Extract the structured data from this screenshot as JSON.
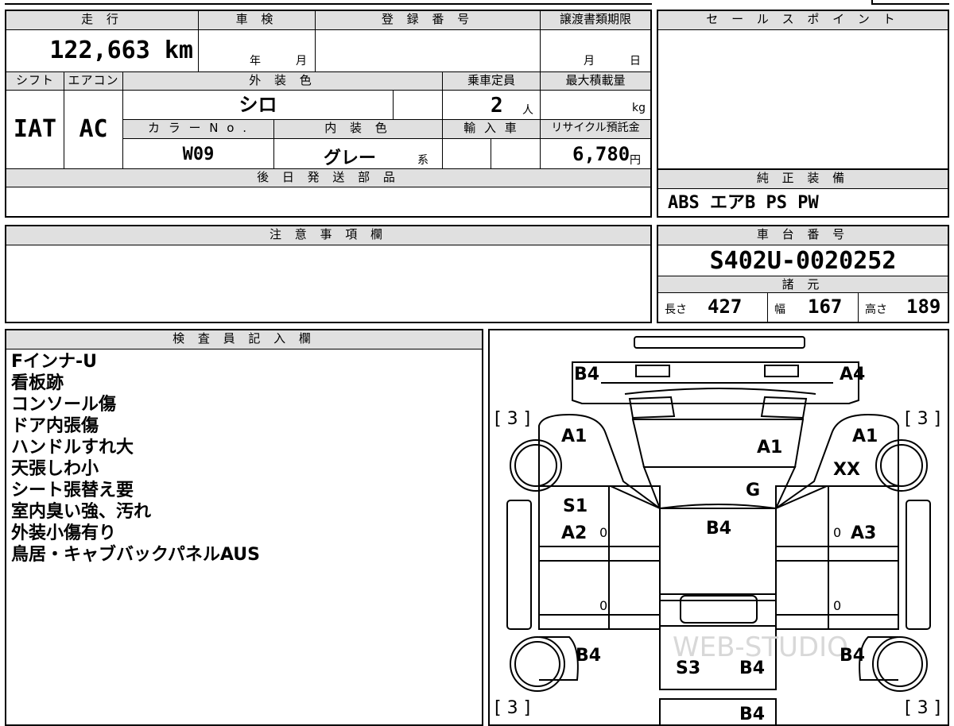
{
  "spec": {
    "labels": {
      "mileage": "走 行",
      "shaken": "車 検",
      "registration": "登 録 番 号",
      "transfer_deadline": "譲渡書類期限",
      "shift": "シフト",
      "aircon": "エアコン",
      "exterior_color": "外 装 色",
      "capacity": "乗車定員",
      "max_load": "最大積載量",
      "color_no": "カ ラ ー N o .",
      "interior_color": "内 装 色",
      "import": "輸 入 車",
      "recycle": "リサイクル預託金",
      "later_parts": "後 日 発 送 部 品"
    },
    "mileage": "122,663 km",
    "shaken_year": "年",
    "shaken_month": "月",
    "deadline_month": "月",
    "deadline_day": "日",
    "shift": "IAT",
    "aircon": "AC",
    "exterior_color": "シロ",
    "capacity": "2",
    "capacity_unit": "人",
    "max_load_unit": "kg",
    "color_no": "W09",
    "interior_color": "グレー",
    "interior_suffix": "系",
    "recycle_fee": "6,780",
    "recycle_unit": "円"
  },
  "sales_point": {
    "header": "セ ー ル ス ポ イ ン ト"
  },
  "equipment": {
    "header": "純 正 装 備",
    "value": "ABS エアB PS PW"
  },
  "notes": {
    "header": "注 意 事 項 欄"
  },
  "chassis": {
    "header": "車 台 番 号",
    "number": "S402U-0020252",
    "dims_header": "諸 元",
    "length_label": "長さ",
    "length": "427",
    "width_label": "幅",
    "width": "167",
    "height_label": "高さ",
    "height": "189"
  },
  "inspector": {
    "header": "検 査 員 記 入 欄",
    "lines": [
      "Fインナ-U",
      "看板跡",
      "コンソール傷",
      "ドア内張傷",
      "ハンドルすれ大",
      "天張しわ小",
      "シート張替え要",
      "室内臭い強、汚れ",
      "外装小傷有り",
      "鳥居・キャブバックパネルAUS"
    ]
  },
  "diagram": {
    "marks": {
      "front_left": "B4",
      "front_right": "A4",
      "tire_fl": "[ 3 ]",
      "tire_fr": "[ 3 ]",
      "tire_rl": "[ 3 ]",
      "tire_rr": "[ 3 ]",
      "fender_left": "A1",
      "hood": "A1",
      "fender_right": "A1",
      "wheel_right": "XX",
      "windshield": "G",
      "door_left_1": "S1",
      "door_left_2": "A2",
      "roof": "B4",
      "door_right": "A3",
      "rear_left": "B4",
      "bed_1": "S3",
      "bed_2": "B4",
      "rear_right": "B4",
      "bed_rear": "B4"
    },
    "zeros": [
      "0",
      "0",
      "0",
      "0"
    ],
    "watermark": "WEB-STUDIO"
  }
}
